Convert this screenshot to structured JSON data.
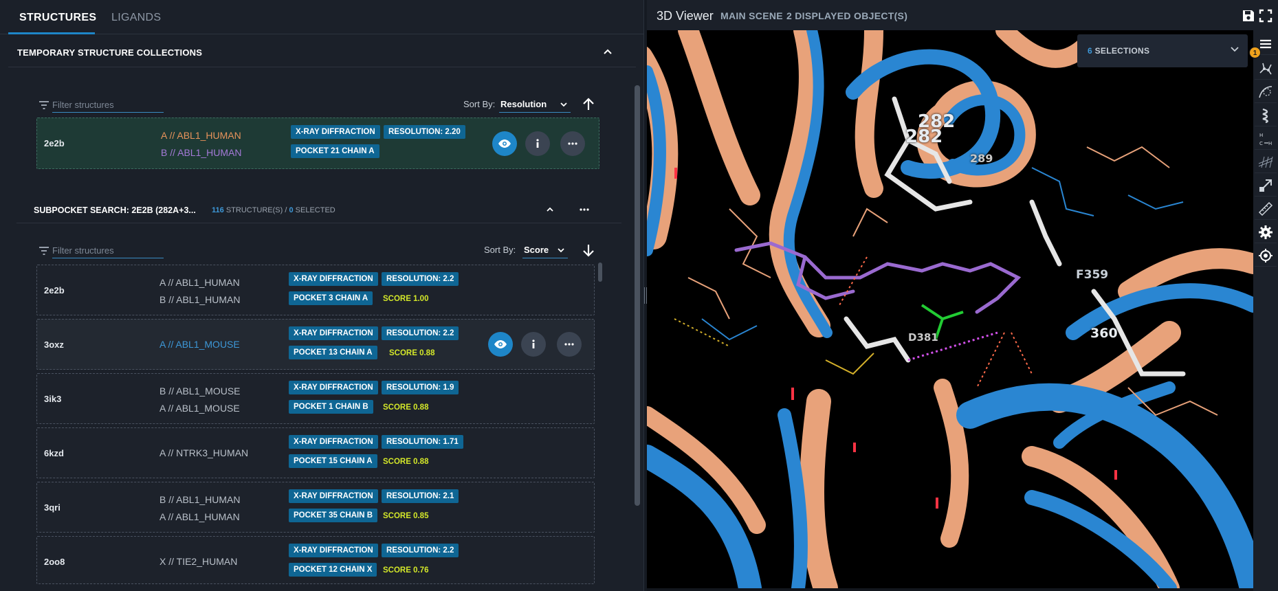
{
  "tabs": [
    {
      "label": "STRUCTURES"
    },
    {
      "label": "LIGANDS"
    }
  ],
  "collections": {
    "title": "TEMPORARY STRUCTURE COLLECTIONS",
    "filter_placeholder": "Filter structures",
    "sort_label": "Sort By:",
    "sort_value": "Resolution",
    "item": {
      "id": "2e2b",
      "chains": [
        "A // ABL1_HUMAN",
        "B // ABL1_HUMAN"
      ],
      "method": "X-RAY DIFFRACTION",
      "resolution": "RESOLUTION: 2.20",
      "pocket": "POCKET 21 CHAIN A"
    }
  },
  "subpocket": {
    "title": "SUBPOCKET SEARCH: 2E2B (282A+3...",
    "count_num": "116",
    "count_label": "STRUCTURE(S) /",
    "selected_num": "0",
    "selected_label": "SELECTED",
    "filter_placeholder": "Filter structures",
    "sort_label": "Sort By:",
    "sort_value": "Score",
    "results": [
      {
        "id": "2e2b",
        "chains": [
          "A // ABL1_HUMAN",
          "B // ABL1_HUMAN"
        ],
        "method": "X-RAY DIFFRACTION",
        "resolution": "RESOLUTION: 2.2",
        "pocket": "POCKET 3 CHAIN A",
        "score": "SCORE 1.00"
      },
      {
        "id": "3oxz",
        "chains": [
          "A // ABL1_MOUSE"
        ],
        "method": "X-RAY DIFFRACTION",
        "resolution": "RESOLUTION: 2.2",
        "pocket": "POCKET 13 CHAIN A",
        "score": "SCORE 0.88"
      },
      {
        "id": "3ik3",
        "chains": [
          "B // ABL1_MOUSE",
          "A // ABL1_MOUSE"
        ],
        "method": "X-RAY DIFFRACTION",
        "resolution": "RESOLUTION: 1.9",
        "pocket": "POCKET 1 CHAIN B",
        "score": "SCORE 0.88"
      },
      {
        "id": "6kzd",
        "chains": [
          "A // NTRK3_HUMAN"
        ],
        "method": "X-RAY DIFFRACTION",
        "resolution": "RESOLUTION: 1.71",
        "pocket": "POCKET 15 CHAIN A",
        "score": "SCORE 0.88"
      },
      {
        "id": "3qri",
        "chains": [
          "B // ABL1_HUMAN",
          "A // ABL1_HUMAN"
        ],
        "method": "X-RAY DIFFRACTION",
        "resolution": "RESOLUTION: 2.1",
        "pocket": "POCKET 35 CHAIN B",
        "score": "SCORE 0.85"
      },
      {
        "id": "2oo8",
        "chains": [
          "X // TIE2_HUMAN"
        ],
        "method": "X-RAY DIFFRACTION",
        "resolution": "RESOLUTION: 2.2",
        "pocket": "POCKET 12 CHAIN X",
        "score": "SCORE 0.76"
      }
    ]
  },
  "viewer": {
    "title": "3D Viewer",
    "scene": "MAIN SCENE",
    "objects": "2 DISPLAYED OBJECT(S)",
    "selections_num": "6",
    "selections_label": "SELECTIONS",
    "notification_count": "1",
    "residue_labels": [
      "282",
      "282",
      "289",
      "F359",
      "360",
      "D381"
    ]
  },
  "colors": {
    "accent": "#1e86c8",
    "badge": "#0f6694",
    "score": "#d4e829",
    "ribbon_orange": "#e8a27a",
    "ribbon_blue": "#2a86d2",
    "ligand_purple": "#9a6ad0"
  },
  "icons": [
    "filter-icon",
    "chevron-up-icon",
    "chevron-down-icon",
    "arrow-up-icon",
    "arrow-down-icon",
    "eye-icon",
    "info-icon",
    "more-icon",
    "save-icon",
    "fullscreen-icon",
    "menu-icon"
  ]
}
